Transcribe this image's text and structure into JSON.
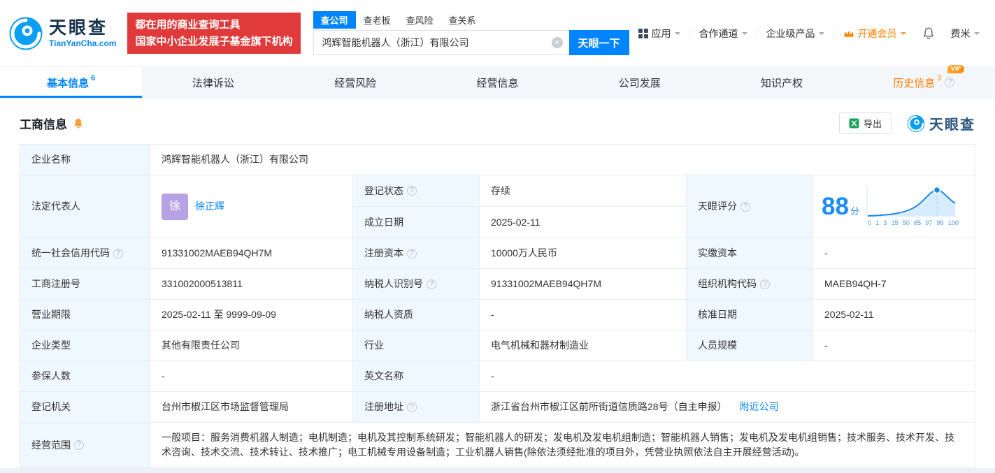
{
  "brand": {
    "name": "天眼查",
    "domain": "TianYanCha.com",
    "promo_line1": "都在用的商业查询工具",
    "promo_line2": "国家中小企业发展子基金旗下机构"
  },
  "search": {
    "tabs": [
      {
        "label": "查公司"
      },
      {
        "label": "查老板"
      },
      {
        "label": "查风险"
      },
      {
        "label": "查关系"
      }
    ],
    "value": "鸿辉智能机器人（浙江）有限公司",
    "button_label": "天眼一下"
  },
  "top_nav": {
    "apps": "应用",
    "cooperation": "合作通道",
    "enterprise": "企业级产品",
    "vip": "开通会员",
    "user": "费米"
  },
  "page_tabs": [
    {
      "label": "基本信息",
      "badge": "6"
    },
    {
      "label": "法律诉讼",
      "badge": ""
    },
    {
      "label": "经营风险",
      "badge": ""
    },
    {
      "label": "经营信息",
      "badge": ""
    },
    {
      "label": "公司发展",
      "badge": ""
    },
    {
      "label": "知识产权",
      "badge": ""
    },
    {
      "label": "历史信息",
      "badge": "3",
      "vip_tag": "VIP"
    }
  ],
  "section": {
    "title": "工商信息",
    "export_label": "导出",
    "logo_text": "天眼查"
  },
  "fields": {
    "company_name": {
      "label": "企业名称",
      "value": "鸿辉智能机器人（浙江）有限公司"
    },
    "legal_rep": {
      "label": "法定代表人",
      "avatar": "徐",
      "value": "徐正辉"
    },
    "reg_status": {
      "label": "登记状态",
      "value": "存续"
    },
    "establish_date": {
      "label": "成立日期",
      "value": "2025-02-11"
    },
    "tyc_score": {
      "label": "天眼评分",
      "score": "88",
      "unit": "分"
    },
    "credit_code": {
      "label": "统一社会信用代码",
      "value": "91331002MAEB94QH7M"
    },
    "reg_capital": {
      "label": "注册资本",
      "value": "10000万人民币"
    },
    "paid_capital": {
      "label": "实缴资本",
      "value": "-"
    },
    "reg_number": {
      "label": "工商注册号",
      "value": "331002000513811"
    },
    "taxpayer_id": {
      "label": "纳税人识别号",
      "value": "91331002MAEB94QH7M"
    },
    "org_code": {
      "label": "组织机构代码",
      "value": "MAEB94QH-7"
    },
    "business_term": {
      "label": "营业期限",
      "value": "2025-02-11 至 9999-09-09"
    },
    "taxpayer_quality": {
      "label": "纳税人资质",
      "value": "-"
    },
    "approve_date": {
      "label": "核准日期",
      "value": "2025-02-11"
    },
    "company_type": {
      "label": "企业类型",
      "value": "其他有限责任公司"
    },
    "industry": {
      "label": "行业",
      "value": "电气机械和器材制造业"
    },
    "staff_scale": {
      "label": "人员规模",
      "value": "-"
    },
    "insured_num": {
      "label": "参保人数",
      "value": "-"
    },
    "english_name": {
      "label": "英文名称",
      "value": "-"
    },
    "reg_authority": {
      "label": "登记机关",
      "value": "台州市椒江区市场监督管理局"
    },
    "reg_address": {
      "label": "注册地址",
      "value": "浙江省台州市椒江区前所街道信质路28号（自主申报）",
      "nearby_link": "附近公司"
    },
    "business_scope": {
      "label": "经营范围",
      "value": "一般项目：服务消费机器人制造；电机制造；电机及其控制系统研发；智能机器人的研发；发电机及发电机组制造；智能机器人销售；发电机及发电机组销售；技术服务、技术开发、技术咨询、技术交流、技术转让、技术推广；电工机械专用设备制造；工业机器人销售(除依法须经批准的项目外，凭营业执照依法自主开展经营活动)。"
    }
  },
  "score_chart": {
    "axis_labels": [
      "0",
      "1",
      "3",
      "15",
      "50",
      "85",
      "97",
      "99",
      "100"
    ]
  },
  "colors": {
    "brand_blue": "#0084ff",
    "promo_red": "#e03a3a",
    "status_green": "#00b365",
    "vip_orange": "#ff8000",
    "history_orange": "#ff7d00"
  }
}
